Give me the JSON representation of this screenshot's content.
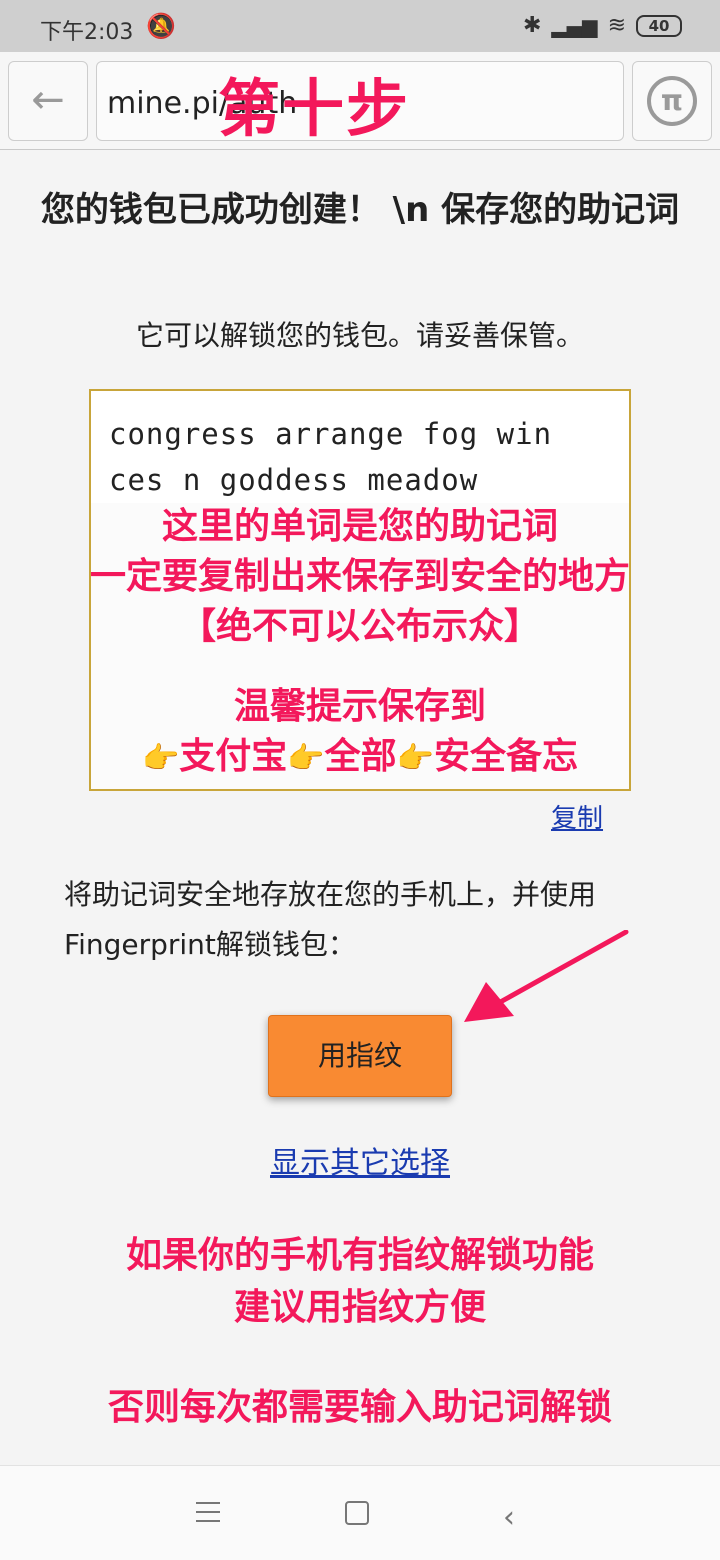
{
  "status_bar": {
    "time": "下午2:03",
    "battery": "40",
    "icons": [
      "mute-bell-icon",
      "bluetooth-icon",
      "signal-icon",
      "wifi-icon",
      "battery-icon"
    ]
  },
  "browser": {
    "url": "mine.pi/auth",
    "step_overlay": "第十步",
    "back_icon": "arrow-left-icon",
    "pi_logo": "π"
  },
  "page": {
    "title": "您的钱包已成功创建！ \\n 保存您的助记词",
    "subtitle": "它可以解锁您的钱包。请妥善保管。",
    "mnemonic": "congress arrange fog win ces  n goddess meadow",
    "copy_link": "复制",
    "info_text": "将助记词安全地存放在您的手机上，并使用Fingerprint解锁钱包：",
    "fingerprint_button": "用指纹",
    "other_options_link": "显示其它选择"
  },
  "annotations": {
    "mnemonic_note_line1": "这里的单词是您的助记词",
    "mnemonic_note_line2": "一定要复制出来保存到安全的地方",
    "mnemonic_note_line3": "【绝不可以公布示众】",
    "tip_line1": "温馨提示保存到",
    "tip_hand": "👉",
    "tip_item1": "支付宝",
    "tip_item2": "全部",
    "tip_item3": "安全备忘",
    "fingerprint_note_line1": "如果你的手机有指纹解锁功能",
    "fingerprint_note_line2": "建议用指纹方便",
    "fingerprint_note_line3": "否则每次都需要输入助记词解锁",
    "accent_color": "#f3185b"
  },
  "nav_bar": {
    "icons": [
      "menu-icon",
      "home-icon",
      "back-icon"
    ]
  }
}
